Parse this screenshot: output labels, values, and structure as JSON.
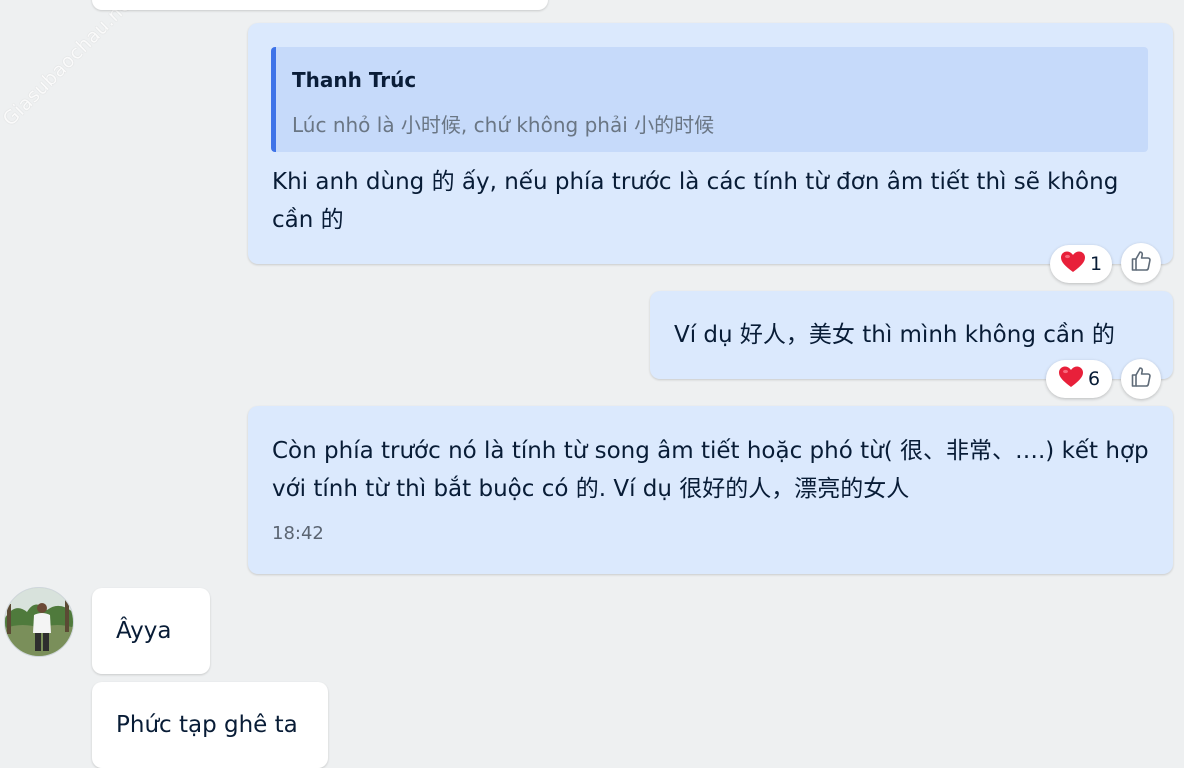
{
  "watermark": "Giasubaochau.net",
  "messages": [
    {
      "quote": {
        "author": "Thanh Trúc",
        "text": "Lúc nhỏ là 小时候, chứ không phải 小的时候"
      },
      "text": "Khi anh dùng 的 ấy, nếu phía trước là các tính từ đơn âm tiết thì sẽ không cần 的",
      "reaction": {
        "icon": "heart",
        "count": "1"
      }
    },
    {
      "text": "Ví dụ 好人，美女 thì mình không cần 的",
      "reaction": {
        "icon": "heart",
        "count": "6"
      }
    },
    {
      "text": "Còn phía trước nó là tính từ song âm tiết hoặc phó từ( 很、非常、….) kết hợp với tính từ thì bắt buộc có 的. Ví dụ 很好的人，漂亮的女人",
      "time": "18:42"
    },
    {
      "text": "Âyya"
    },
    {
      "text": "Phức tạp ghê ta"
    }
  ],
  "colors": {
    "background": "#eef0f1",
    "my_bubble": "#dbe9fd",
    "other_bubble": "#ffffff",
    "quote_bar": "#3e73e8",
    "heart": "#e8203a"
  },
  "icons": {
    "reaction": "heart-icon",
    "like": "thumbs-up-icon"
  }
}
